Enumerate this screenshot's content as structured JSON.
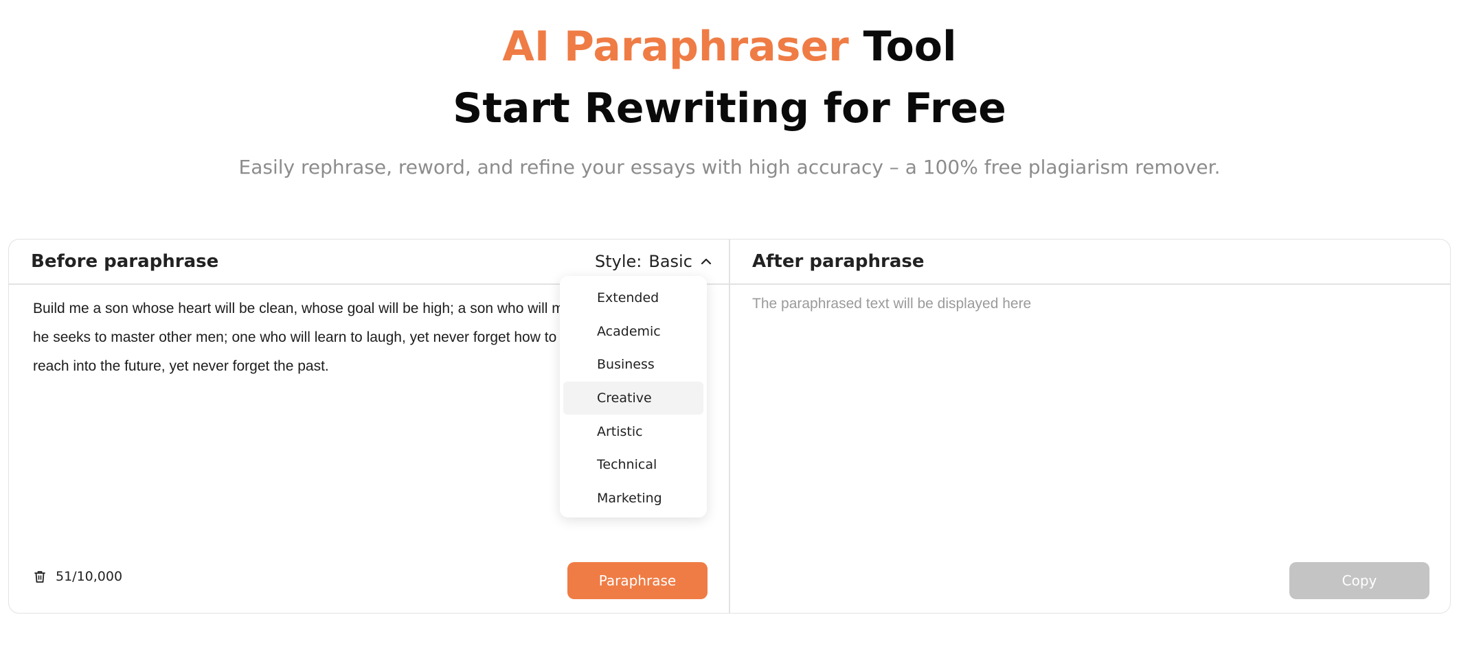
{
  "hero": {
    "title_highlight": "AI Paraphraser",
    "title_rest": "Tool",
    "title_line2": "Start Rewriting for Free",
    "subtitle": "Easily rephrase, reword, and refine your essays with high accuracy – a 100% free plagiarism remover."
  },
  "left": {
    "heading": "Before paraphrase",
    "style_label": "Style:",
    "style_value": "Basic",
    "input_text": "Build me a son whose heart will be clean, whose goal will be high; a son who will master himself before he seeks to master other men; one who will learn to laugh, yet never forget how to weep; one who will reach into the future, yet never forget the past.",
    "char_count": "51/10,000",
    "paraphrase_button": "Paraphrase"
  },
  "right": {
    "heading": "After paraphrase",
    "placeholder": "The paraphrased text will be displayed here",
    "copy_button": "Copy"
  },
  "dropdown": {
    "items": [
      "Extended",
      "Academic",
      "Business",
      "Creative",
      "Artistic",
      "Technical",
      "Marketing"
    ],
    "hovered": "Creative"
  },
  "colors": {
    "accent": "#ef7c45",
    "highlight_bg": "#fdebd8",
    "disabled": "#c4c4c4"
  }
}
